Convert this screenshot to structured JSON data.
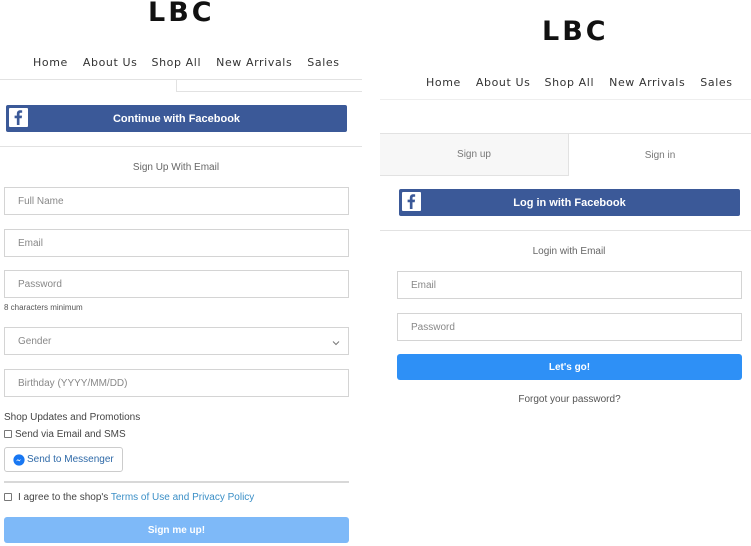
{
  "colors": {
    "facebook": "#3b5998",
    "signup_button": "#7eb9f8",
    "login_button": "#2e90f6",
    "link": "#3b8fc7"
  },
  "icons": {
    "facebook": "facebook-icon",
    "messenger": "messenger-icon",
    "dropdown": "chevron-down-icon"
  },
  "signup_page": {
    "logo": "LBC",
    "nav": [
      "Home",
      "About Us",
      "Shop All",
      "New Arrivals",
      "Sales"
    ],
    "facebook_button": "Continue with Facebook",
    "email_heading": "Sign Up With Email",
    "full_name_placeholder": "Full Name",
    "email_placeholder": "Email",
    "password_placeholder": "Password",
    "password_hint": "8 characters minimum",
    "gender_placeholder": "Gender",
    "birthday_placeholder": "Birthday (YYYY/MM/DD)",
    "promotions_heading": "Shop Updates and Promotions",
    "send_email_sms": "Send via Email and SMS",
    "send_messenger": "Send to Messenger",
    "terms_prefix": "I agree to the shop's",
    "terms_link": "Terms of Use and Privacy Policy",
    "submit": "Sign me up!"
  },
  "login_page": {
    "logo": "LBC",
    "nav": [
      "Home",
      "About Us",
      "Shop All",
      "New Arrivals",
      "Sales"
    ],
    "tabs": [
      {
        "label": "Sign up",
        "active": false
      },
      {
        "label": "Sign in",
        "active": true
      }
    ],
    "facebook_button": "Log in with Facebook",
    "email_heading": "Login with Email",
    "email_placeholder": "Email",
    "password_placeholder": "Password",
    "submit": "Let's go!",
    "forgot_password": "Forgot your password?"
  }
}
